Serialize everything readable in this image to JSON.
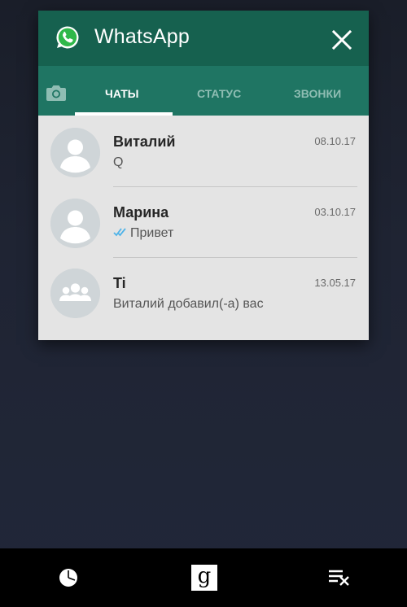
{
  "app": {
    "title": "WhatsApp"
  },
  "tabs": [
    {
      "label": "ЧАТЫ",
      "active": true
    },
    {
      "label": "СТАТУС",
      "active": false
    },
    {
      "label": "ЗВОНКИ",
      "active": false
    }
  ],
  "chats": [
    {
      "name": "Виталий",
      "date": "08.10.17",
      "message": "Q",
      "avatar": "person-avatar-icon",
      "read_ticks": false
    },
    {
      "name": "Марина",
      "date": "03.10.17",
      "message": "Привет",
      "avatar": "person-avatar-icon",
      "read_ticks": true
    },
    {
      "name": "Ti",
      "date": "13.05.17",
      "message": "Виталий добавил(-а) вас",
      "avatar": "group-avatar-icon",
      "read_ticks": false
    }
  ],
  "navbar": {
    "google_glyph": "g",
    "icons": [
      "pie-chart-icon",
      "google-search-icon",
      "clear-all-icon"
    ]
  },
  "colors": {
    "header": "#16614f",
    "tabs": "#1f7563",
    "read_ticks": "#4fb3e8",
    "background": "#1f2433"
  }
}
